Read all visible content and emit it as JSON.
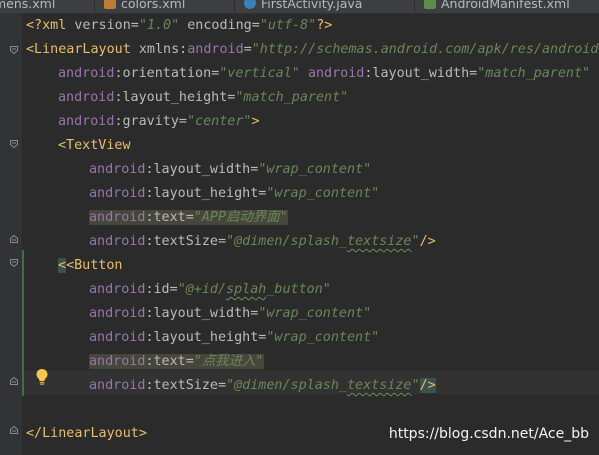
{
  "tabs": [
    {
      "label": "mens.xml",
      "icon": "xml-file-icon"
    },
    {
      "label": "colors.xml",
      "icon": "xml-file-icon"
    },
    {
      "label": "FirstActivity.java",
      "icon": "java-class-icon"
    },
    {
      "label": "AndroidManifest.xml",
      "icon": "manifest-file-icon"
    }
  ],
  "code": {
    "prolog": {
      "open": "<?xml",
      "a1": " version=",
      "v1": "\"1.0\"",
      "a2": " encoding=",
      "v2": "\"utf-8\"",
      "close": "?>"
    },
    "ll_open": {
      "tag": "<LinearLayout",
      "a1": " xmlns:",
      "ns1": "android",
      "eq1": "=",
      "v1": "\"http://schemas.android.com/apk/res/android\""
    },
    "ll_orient": {
      "ns": "android",
      "attr": ":orientation=",
      "val": "\"vertical\"",
      "ns2": "android",
      "attr2": ":layout_width=",
      "val2": "\"match_parent\""
    },
    "ll_height": {
      "ns": "android",
      "attr": ":layout_height=",
      "val": "\"match_parent\""
    },
    "ll_gravity": {
      "ns": "android",
      "attr": ":gravity=",
      "val": "\"center\"",
      "close": ">"
    },
    "tv_open": "<TextView",
    "tv_width": {
      "ns": "android",
      "attr": ":layout_width=",
      "val": "\"wrap_content\""
    },
    "tv_height": {
      "ns": "android",
      "attr": ":layout_height=",
      "val": "\"wrap_content\""
    },
    "tv_text": {
      "ns": "android",
      "attr": ":text=",
      "val": "\"APP启动界面\""
    },
    "tv_size": {
      "ns": "android",
      "attr": ":textSize=",
      "val_pre": "\"@dimen/splash_",
      "val_sq": "textsize",
      "val_post": "\"",
      "close": "/>"
    },
    "btn_open": "<Button",
    "btn_id": {
      "ns": "android",
      "attr": ":id=",
      "val_pre": "\"@+id/",
      "val_sq": "splah",
      "val_post": "_button\""
    },
    "btn_width": {
      "ns": "android",
      "attr": ":layout_width=",
      "val": "\"wrap_content\""
    },
    "btn_height": {
      "ns": "android",
      "attr": ":layout_height=",
      "val": "\"wrap_content\""
    },
    "btn_text": {
      "ns": "android",
      "attr": ":text=",
      "val": "\"点我进入\""
    },
    "btn_size": {
      "ns": "android",
      "attr": ":textSize=",
      "val_pre": "\"@dimen/splash_",
      "val_sq": "textsize",
      "val_post": "\"",
      "close": "/>"
    },
    "ll_close": "</LinearLayout>"
  },
  "watermark": "https://blog.csdn.net/Ace_bb",
  "colors": {
    "bg": "#2b2b2b",
    "tag": "#e8bf6a",
    "namespace": "#9876aa",
    "value": "#6a8759"
  }
}
